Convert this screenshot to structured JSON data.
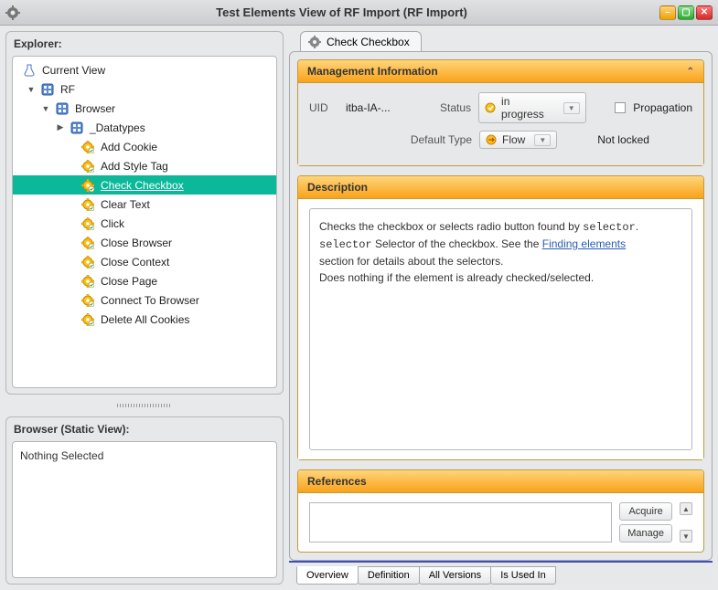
{
  "window": {
    "title": "Test Elements View of RF Import (RF Import)"
  },
  "explorer": {
    "title": "Explorer:",
    "tree": {
      "root": "Current View",
      "rf": "RF",
      "browser": "Browser",
      "datatypes": "_Datatypes",
      "items": [
        "Add Cookie",
        "Add Style Tag",
        "Check Checkbox",
        "Clear Text",
        "Click",
        "Close Browser",
        "Close Context",
        "Close Page",
        "Connect To Browser",
        "Delete All Cookies"
      ],
      "selected_index": 2
    }
  },
  "static_view": {
    "title": "Browser (Static View):",
    "content": "Nothing Selected"
  },
  "tab": {
    "label": "Check Checkbox"
  },
  "mgmt": {
    "header": "Management Information",
    "uid_label": "UID",
    "uid_value": "itba-IA-...",
    "status_label": "Status",
    "status_value": "in progress",
    "propagation_label": "Propagation",
    "default_type_label": "Default Type",
    "default_type_value": "Flow",
    "lock_label": "Not locked"
  },
  "description": {
    "header": "Description",
    "line1_a": "Checks the checkbox or selects radio button found by ",
    "line1_code": "selector",
    "line1_b": ".",
    "line2_code": "selector",
    "line2_a": " Selector of the checkbox. See the ",
    "line2_link": "Finding elements",
    "line3": "section for details about the selectors.",
    "line4": "Does nothing if the element is already checked/selected."
  },
  "references": {
    "header": "References",
    "acquire": "Acquire",
    "manage": "Manage"
  },
  "bottom_tabs": [
    "Overview",
    "Definition",
    "All Versions",
    "Is Used In"
  ]
}
